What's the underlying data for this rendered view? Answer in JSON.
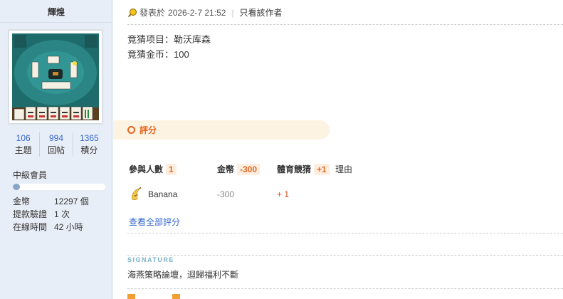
{
  "author": {
    "name": "輝煌",
    "stats": [
      {
        "value": "106",
        "label": "主題"
      },
      {
        "value": "994",
        "label": "回帖"
      },
      {
        "value": "1365",
        "label": "積分"
      }
    ],
    "rank": "中級會員",
    "rank_progress": 0.08,
    "info": [
      {
        "label": "金幣",
        "value": "12297 個"
      },
      {
        "label": "提款驗證",
        "value": "1 次"
      },
      {
        "label": "在線時間",
        "value": "42 小時"
      }
    ]
  },
  "post": {
    "meta_posted": "發表於",
    "meta_date": "2026-2-7 21:52",
    "meta_sep": "|",
    "author_only": "只看該作者",
    "content": [
      "竟猜项目：勒沃库森",
      "竟猜金币：100"
    ]
  },
  "rating": {
    "title": "評分",
    "participants_label": "參與人數",
    "participants_count": "1",
    "gold_label": "金幣",
    "gold_total": "-300",
    "sport_label": "體育競猜",
    "sport_total": "+1",
    "reason_label": "理由",
    "rows": [
      {
        "user": "Banana",
        "gold": "-300",
        "sport": "+ 1"
      }
    ],
    "view_all": "查看全部評分"
  },
  "signature": {
    "title": "SIGNATURE",
    "text": "海燕策略論壇，迴歸福利不斷"
  },
  "colors": {
    "sidebar_bg": "#e8eef7",
    "accent_orange": "#e66622",
    "link_blue": "#3366cc"
  }
}
